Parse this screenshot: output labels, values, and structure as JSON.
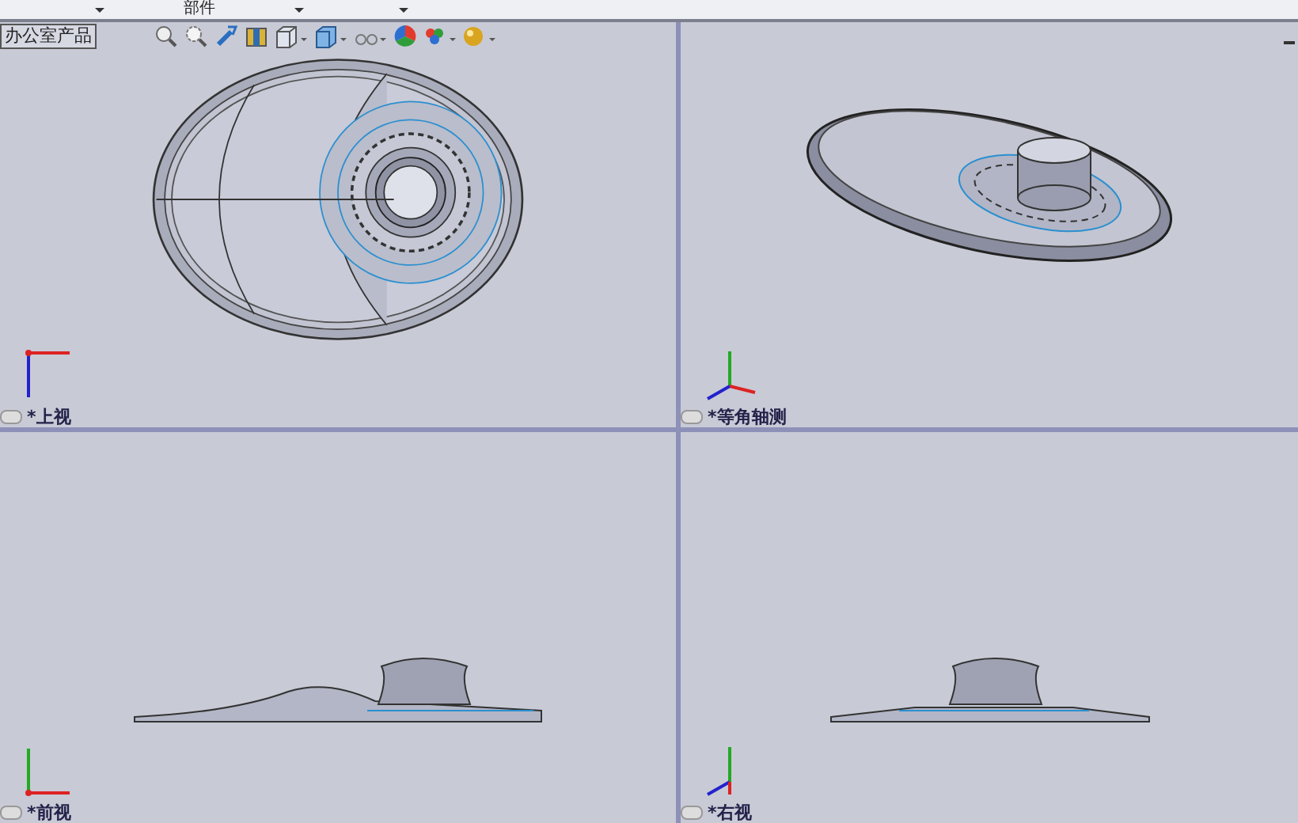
{
  "tab_bar": {
    "tabs": [
      {
        "label": "部件"
      }
    ]
  },
  "document": {
    "name": "办公室产品"
  },
  "viewports": [
    {
      "kind": "top",
      "label": "*上视"
    },
    {
      "kind": "iso",
      "label": "*等角轴测"
    },
    {
      "kind": "front",
      "label": "*前视"
    },
    {
      "kind": "right",
      "label": "*右视"
    }
  ]
}
